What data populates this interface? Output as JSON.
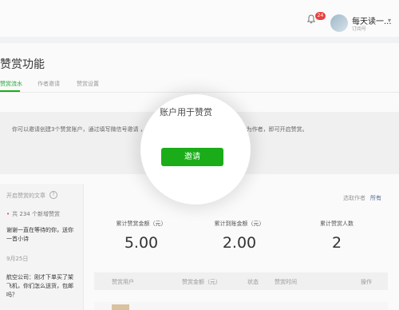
{
  "header": {
    "notification_count": "24",
    "account_name": "每天读一...",
    "account_type": "订阅号"
  },
  "page": {
    "title": "赞赏功能",
    "tabs": [
      {
        "label": "赞赏流水",
        "active": true
      },
      {
        "label": "作者邀请",
        "active": false
      },
      {
        "label": "赞赏设置",
        "active": false
      }
    ]
  },
  "notice": {
    "text": "你可以邀请创建3个赞赏账户，通过填写微信号邀请                                    ，你在文章声明原创时，选择这个账户名作为作者，即可开启赞赏。"
  },
  "spotlight": {
    "text": "账户用于赞赏",
    "button_label": "邀请"
  },
  "sidebar": {
    "header": "开启赞赏的文章",
    "new_count_text": "共 234 个新增赞赏",
    "message1": "谢谢一直在等待的你，送你一首小诗",
    "date": "9月25日",
    "message2": "航空公司：刚才下单买了架飞机，你们怎么送货，包邮吗？"
  },
  "summary": {
    "link_author": "选取作者",
    "link_all": "所有",
    "stats": [
      {
        "label": "累计赞赏金额（元）",
        "value": "5.00"
      },
      {
        "label": "累计到账金额（元）",
        "value": "2.00"
      },
      {
        "label": "累计赞赏人数",
        "value": "2"
      }
    ]
  },
  "table": {
    "headers": [
      "赞赏用户",
      "赞赏金额（元）",
      "状态",
      "赞赏时间",
      "操作"
    ]
  },
  "colors": {
    "brand_green": "#1aad19",
    "badge_red": "#e64340",
    "link_blue": "#576b95"
  }
}
